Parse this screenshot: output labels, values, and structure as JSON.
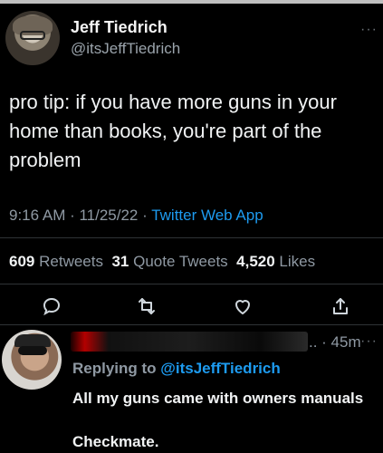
{
  "tweet": {
    "author_name": "Jeff Tiedrich",
    "author_handle": "@itsJeffTiedrich",
    "text": "pro tip: if you have more guns in your home than books, you're part of the problem",
    "timestamp": "9:16 AM · 11/25/22 · ",
    "app": "Twitter Web App",
    "stats": {
      "retweets_count": "609",
      "retweets_label": "Retweets",
      "quotes_count": "31",
      "quotes_label": "Quote Tweets",
      "likes_count": "4,520",
      "likes_label": "Likes"
    },
    "more": "···"
  },
  "actions": [
    {
      "name": "reply-icon"
    },
    {
      "name": "retweet-icon"
    },
    {
      "name": "like-icon"
    },
    {
      "name": "share-icon"
    }
  ],
  "reply": {
    "time": ".. · 45m",
    "replying_prefix": "Replying to ",
    "replying_handle": "@itsJeffTiedrich",
    "line1": "All my guns came with owners manuals",
    "line2": "Checkmate.",
    "more": "···"
  },
  "colors": {
    "background": "#000000",
    "accent": "#1d9bf0",
    "muted": "#8f99a3",
    "text": "#f1f3f4"
  }
}
